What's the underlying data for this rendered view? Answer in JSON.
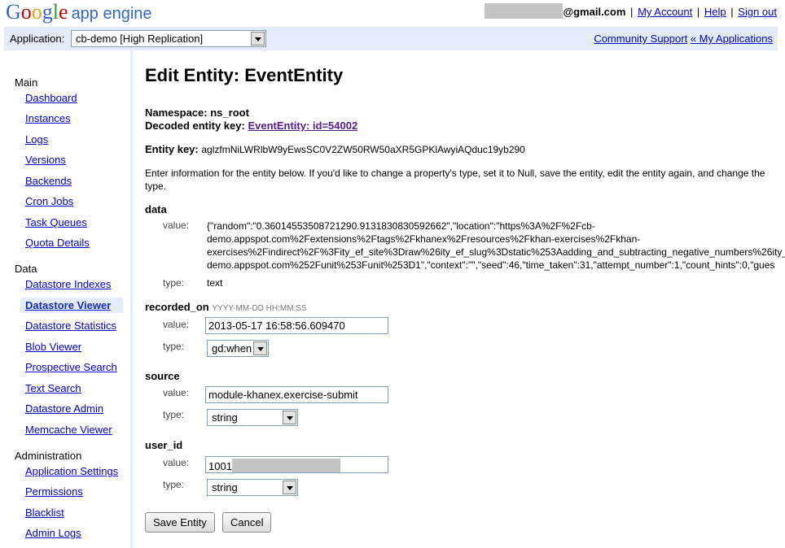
{
  "header": {
    "logo_google": "Google",
    "logo_product": "app engine",
    "user_email_suffix": "@gmail.com",
    "my_account": "My Account",
    "help": "Help",
    "sign_out": "Sign out",
    "separator": "|"
  },
  "appbar": {
    "label": "Application:",
    "selected_app": "cb-demo [High Replication]",
    "community_support": "Community Support",
    "my_applications": "« My Applications"
  },
  "sidebar": {
    "sections": [
      {
        "title": "Main",
        "items": [
          "Dashboard",
          "Instances",
          "Logs",
          "Versions",
          "Backends",
          "Cron Jobs",
          "Task Queues",
          "Quota Details"
        ]
      },
      {
        "title": "Data",
        "items": [
          "Datastore Indexes",
          "Datastore Viewer",
          "Datastore Statistics",
          "Blob Viewer",
          "Prospective Search",
          "Text Search",
          "Datastore Admin",
          "Memcache Viewer"
        ]
      },
      {
        "title": "Administration",
        "items": [
          "Application Settings",
          "Permissions",
          "Blacklist",
          "Admin Logs"
        ]
      }
    ],
    "active_item": "Datastore Viewer"
  },
  "page": {
    "title": "Edit Entity: EventEntity",
    "namespace_label": "Namespace:",
    "namespace_value": "ns_root",
    "decoded_key_label": "Decoded entity key:",
    "decoded_key_value": "EventEntity: id=54002",
    "entity_key_label": "Entity key:",
    "entity_key_value": "aglzfmNiLWRlbW9yEwsSC0V2ZW50RW50aXR5GPKlAwyiAQduc19yb290",
    "description": "Enter information for the entity below. If you'd like to change a property's type, set it to Null, save the entity, edit the entity again, and change the type."
  },
  "fields": {
    "value_label": "value:",
    "type_label": "type:",
    "data": {
      "name": "data",
      "value_lines": [
        "{\"random\":\"0.36014553508721290.9131830830592662\",\"location\":\"https%3A%2F%2Fcb-",
        "demo.appspot.com%2Fextensions%2Ftags%2Fkhanex%2Fresources%2Fkhan-exercises%2Fkhan-",
        "exercises%2Findirect%2F%3Fity_ef_site%3Draw%26ity_ef_slug%3Dstatic%253Aadding_and_subtracting_negative_numbers%26ity_",
        "demo.appspot.com%252Funit%253Funit%253D1\",\"context\":\"\",\"seed\":46,\"time_taken\":31,\"attempt_number\":1,\"count_hints\":0,\"gues"
      ],
      "type": "text"
    },
    "recorded_on": {
      "name": "recorded_on",
      "hint": "YYYY-MM-DD HH:MM:SS",
      "value": "2013-05-17 16:58:56.609470",
      "type": "gd:when"
    },
    "source": {
      "name": "source",
      "value": "module-khanex.exercise-submit",
      "type": "string"
    },
    "user_id": {
      "name": "user_id",
      "value_prefix": "1001",
      "type": "string"
    }
  },
  "buttons": {
    "save": "Save Entity",
    "cancel": "Cancel"
  }
}
